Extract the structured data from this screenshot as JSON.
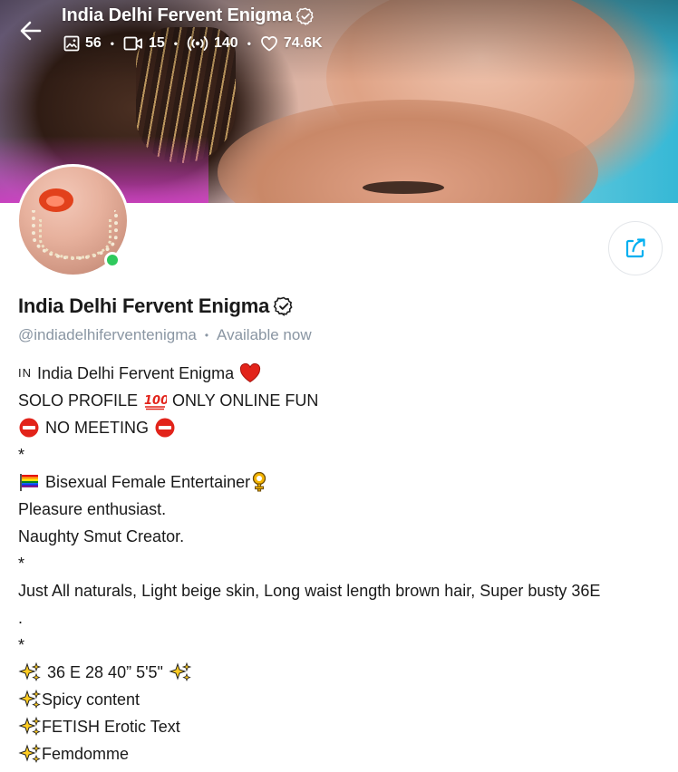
{
  "header": {
    "title": "India Delhi Fervent Enigma",
    "stats": {
      "photos": "56",
      "videos": "15",
      "streams": "140",
      "likes": "74.6K"
    }
  },
  "profile": {
    "name": "India Delhi Fervent Enigma",
    "handle": "@indiadelhiferventenigma",
    "status": "Available now",
    "online": true
  },
  "bio": {
    "line1": "India Delhi Fervent Enigma",
    "line1_flag": "IN",
    "line2": "SOLO PROFILE",
    "line2b": "ONLY ONLINE FUN",
    "line3": "NO MEETING",
    "line4": "*",
    "line5": "Bisexual Female Entertainer",
    "line6": "Pleasure enthusiast.",
    "line7": "Naughty Smut Creator.",
    "line8": "*",
    "line9": "Just All naturals, Light beige skin, Long waist length brown hair, Super busty 36E",
    "line10": ".",
    "line11": "*",
    "line12": "36 E 28 40” 5'5\"",
    "line13": "Spicy content",
    "line14": "FETISH Erotic Text",
    "line15": "Femdomme"
  },
  "icons": {
    "back": "arrow-left-icon",
    "verified": "verified-badge-icon",
    "photo": "image-icon",
    "video": "video-icon",
    "stream": "broadcast-icon",
    "like": "heart-icon",
    "share": "share-icon"
  },
  "colors": {
    "accent": "#00aff0",
    "online": "#2fc95d",
    "muted": "#8a96a3"
  }
}
